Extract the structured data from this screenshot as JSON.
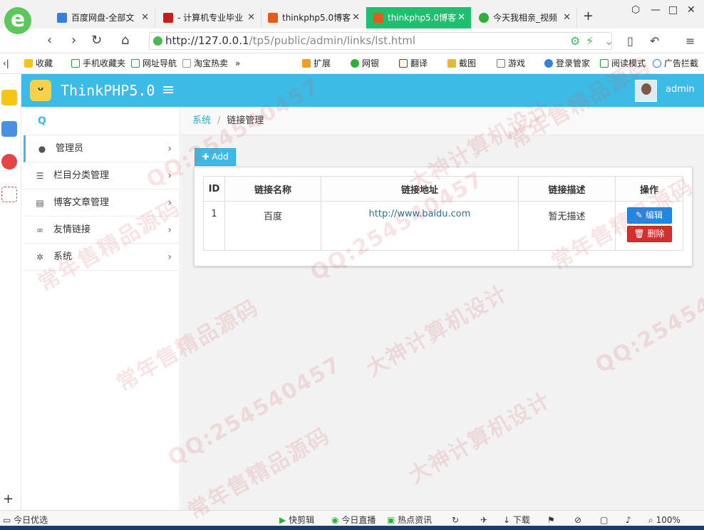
{
  "browser": {
    "tabs": [
      {
        "title": "百度网盘-全部文",
        "icon_color": "#3a7de0"
      },
      {
        "title": "- 计算机专业毕业",
        "icon_color": "#c21f1f"
      },
      {
        "title": "thinkphp5.0博客",
        "icon_color": "#e35b1d"
      },
      {
        "title": "thinkphp5.0博客",
        "icon_color": "#ffffff",
        "active": true
      },
      {
        "title": "今天我相亲_视频",
        "icon_color": "#2fae3a"
      }
    ],
    "url_host": "http://127.0.0.1",
    "url_path": "/tp5/public/admin/links/lst.html",
    "favorites": [
      "收藏",
      "手机收藏夹",
      "网址导航",
      "淘宝热卖",
      "»",
      "扩展",
      "网银",
      "翻译",
      "截图",
      "游戏",
      "登录管家",
      "阅读模式",
      "广告拦截"
    ],
    "colors": {
      "accent": "#3bbbe5",
      "tab_active": "#1fbf6f"
    }
  },
  "app": {
    "title": "ThinkPHP5.0",
    "admin_name": "admin"
  },
  "sidebar": {
    "items": [
      {
        "label": "管理员",
        "icon": "user-icon"
      },
      {
        "label": "栏目分类管理",
        "icon": "list-icon"
      },
      {
        "label": "博客文章管理",
        "icon": "file-icon"
      },
      {
        "label": "友情链接",
        "icon": "link-icon"
      },
      {
        "label": "系统",
        "icon": "gear-icon"
      }
    ]
  },
  "breadcrumb": {
    "root": "系统",
    "current": "链接管理"
  },
  "toolbar": {
    "add_label": "Add"
  },
  "table": {
    "headers": [
      "ID",
      "链接名称",
      "链接地址",
      "链接描述",
      "操作"
    ],
    "rows": [
      {
        "id": "1",
        "name": "百度",
        "url": "http://www.baidu.com",
        "desc": "暂无描述",
        "edit": "编辑",
        "delete": "删除"
      }
    ]
  },
  "statusbar": {
    "left": "今日优选",
    "items": [
      "快剪辑",
      "今日直播",
      "热点资讯",
      "下载",
      "100%"
    ]
  },
  "watermarks": [
    "常年售精品源码",
    "QQ:254540457",
    "大神计算机设计"
  ]
}
